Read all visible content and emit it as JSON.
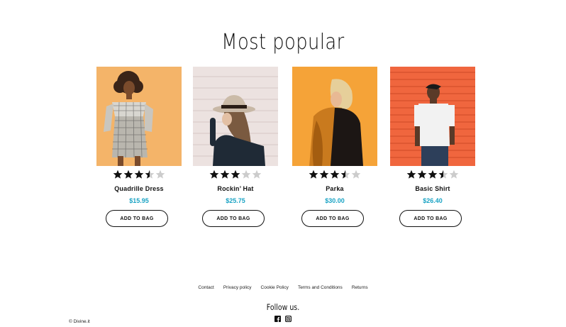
{
  "page": {
    "title": "Most popular"
  },
  "products": [
    {
      "name": "Quadrille Dress",
      "price": "$15.95",
      "rating": 3.5,
      "rating_max": 5,
      "button_label": "ADD TO BAG"
    },
    {
      "name": "Rockin’ Hat",
      "price": "$25.75",
      "rating": 3,
      "rating_max": 5,
      "button_label": "ADD TO BAG"
    },
    {
      "name": "Parka",
      "price": "$30.00",
      "rating": 3.5,
      "rating_max": 5,
      "button_label": "ADD TO BAG"
    },
    {
      "name": "Basic Shirt",
      "price": "$26.40",
      "rating": 3.5,
      "rating_max": 5,
      "button_label": "ADD TO BAG"
    }
  ],
  "footer": {
    "links": [
      "Contact",
      "Privacy policy",
      "Cookie Policy",
      "Terms and Conditions",
      "Returns"
    ],
    "follow_label": "Follow us.",
    "social_icons": [
      "facebook-icon",
      "instagram-icon"
    ],
    "copyright": "© Divine.it"
  },
  "colors": {
    "price": "#1aa3c4",
    "star_filled": "#111111",
    "star_empty": "#cccccc"
  }
}
